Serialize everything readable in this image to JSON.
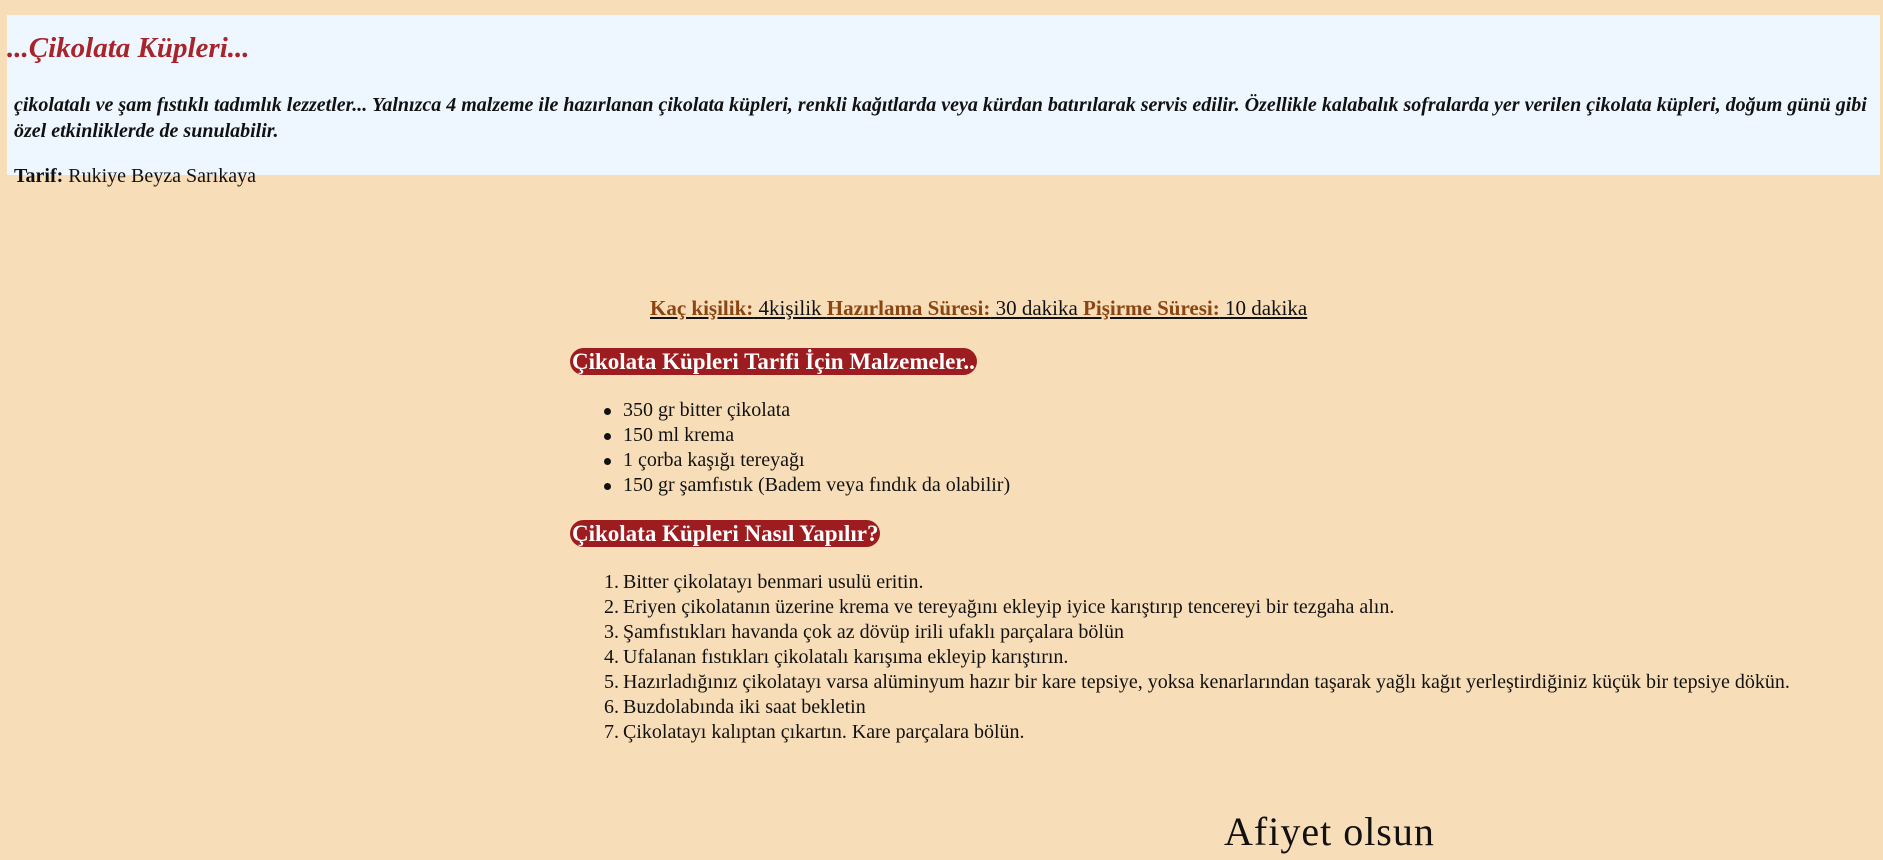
{
  "header": {
    "title": "...Çikolata Küpleri...",
    "intro": "çikolatalı ve şam fıstıklı tadımlık lezzetler... Yalnızca 4 malzeme ile hazırlanan çikolata küpleri, renkli kağıtlarda veya kürdan batırılarak servis edilir. Özellikle kalabalık sofralarda yer verilen çikolata küpleri, doğum günü gibi özel etkinliklerde de sunulabilir.",
    "author_label": "Tarif:",
    "author_name": " Rukiye Beyza Sarıkaya"
  },
  "meta": {
    "servings_label": "Kaç kişilik:",
    "servings_value": " 4kişilik ",
    "prep_label": "Hazırlama Süresi:",
    "prep_value": " 30 dakika ",
    "cook_label": "Pişirme Süresi:",
    "cook_value": " 10 dakika"
  },
  "ingredients": {
    "heading": "Çikolata Küpleri Tarifi İçin Malzemeler..",
    "items": [
      "350 gr bitter çikolata",
      "150 ml krema",
      "1 çorba kaşığı tereyağı",
      "150 gr şamfıstık (Badem veya fındık da olabilir)"
    ]
  },
  "steps": {
    "heading": "Çikolata Küpleri Nasıl Yapılır?",
    "numbers": [
      "1.",
      "2.",
      "3.",
      "4.",
      "5.",
      "6.",
      "7."
    ],
    "items": [
      "Bitter çikolatayı benmari usulü eritin.",
      "Eriyen çikolatanın üzerine krema ve tereyağını ekleyip iyice karıştırıp tencereyi bir tezgaha alın.",
      "Şamfıstıkları havanda çok az dövüp irili ufaklı parçalara bölün",
      "Ufalanan fıstıkları çikolatalı karışıma ekleyip karıştırın.",
      "Hazırladığınız çikolatayı varsa alüminyum hazır bir kare tepsiye, yoksa kenarlarından taşarak yağlı kağıt yerleştirdiğiniz küçük bir tepsiye dökün.",
      "Buzdolabında iki saat bekletin",
      "Çikolatayı kalıptan çıkartın. Kare parçalara bölün."
    ]
  },
  "closing": "Afiyet olsun",
  "colors": {
    "page_background": "#F8DEB8",
    "header_background": "#EEF7FF",
    "title_color": "#A8242A",
    "heading_background": "#9C1C1F",
    "meta_label_color": "#8B4513"
  }
}
